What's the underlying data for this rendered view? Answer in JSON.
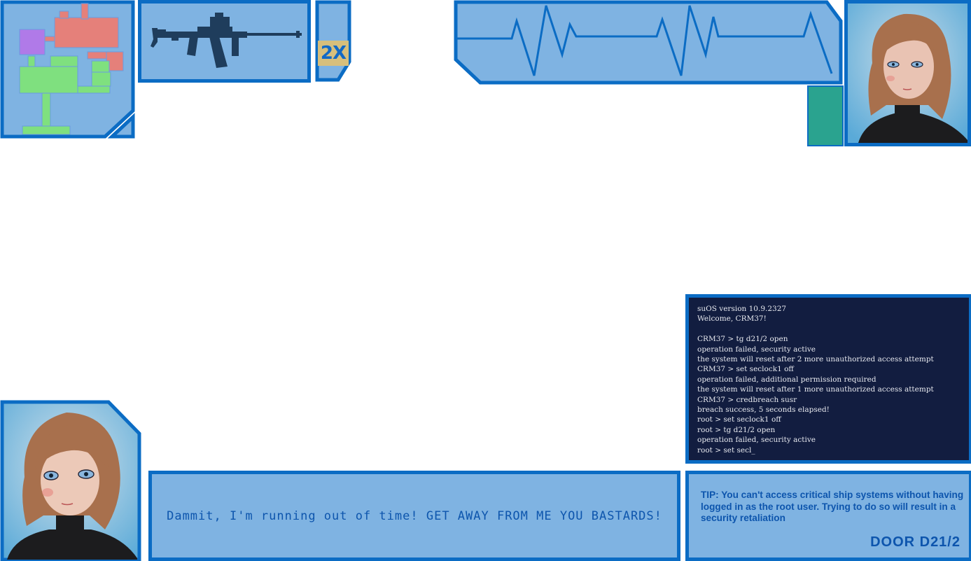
{
  "hud": {
    "ammo_multiplier": "2X",
    "weapon_icon": "assault-rifle-icon"
  },
  "terminal": {
    "lines": [
      "suOS version 10.9.2327",
      "Welcome, CRM37!",
      "",
      "CRM37 > tg d21/2 open",
      "operation failed, security active",
      "the system will reset after 2 more unauthorized access attempt",
      "CRM37 > set seclock1 off",
      "operation failed, additional permission required",
      "the system will reset after 1 more unauthorized access attempt",
      "CRM37 > credbreach susr",
      "breach success, 5 seconds elapsed!",
      "root > set seclock1 off",
      "root > tg d21/2 open",
      "operation failed, security active",
      "root > set secl_"
    ]
  },
  "dialogue": {
    "text": "Dammit, I'm running out of time! GET AWAY FROM ME YOU BASTARDS!"
  },
  "tip": {
    "text": "TIP: You can't access critical ship systems without having logged in as the root user. Trying to do so will result in a security retaliation",
    "door": "DOOR D21/2"
  },
  "colors": {
    "panel": "#7fb3e2",
    "border": "#0b6cc4",
    "terminal_bg": "#121d40",
    "text": "#0d55ad",
    "minimap_room_red": "#e5807a",
    "minimap_room_green": "#7fe07f",
    "minimap_room_purple": "#b07ae8",
    "status_teal": "#2aa38f",
    "ammo_badge": "#d7bf7c"
  }
}
